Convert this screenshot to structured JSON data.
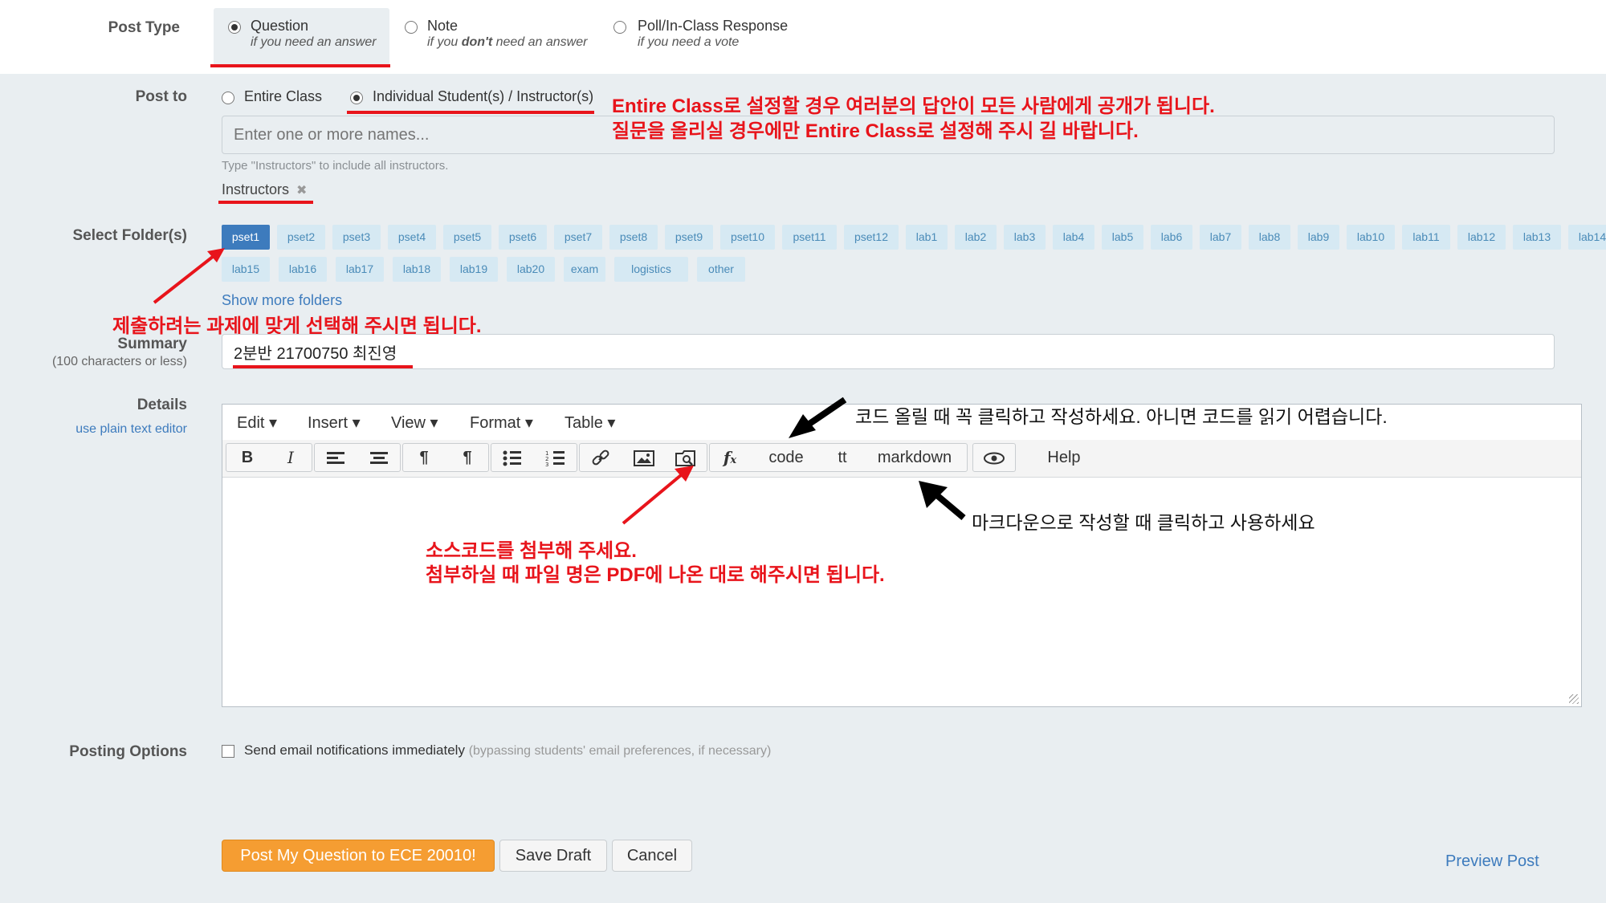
{
  "post_type": {
    "label": "Post Type",
    "options": [
      {
        "title": "Question",
        "sub": "if you need an answer",
        "selected": true
      },
      {
        "title": "Note",
        "sub_pre": "if you ",
        "sub_em": "don't",
        "sub_post": " need an answer",
        "selected": false
      },
      {
        "title": "Poll/In-Class Response",
        "sub": "if you need a vote",
        "selected": false
      }
    ]
  },
  "post_to": {
    "label": "Post to",
    "entire_class": "Entire Class",
    "individual": "Individual Student(s) / Instructor(s)",
    "selected": "individual",
    "names_placeholder": "Enter one or more names...",
    "hint": "Type \"Instructors\" to include all instructors.",
    "token": "Instructors"
  },
  "annotations": {
    "post_to_note_1": "Entire Class로 설정할 경우 여러분의 답안이 모든 사람에게 공개가 됩니다.",
    "post_to_note_2": "질문을 올리실 경우에만 Entire Class로 설정해 주시 길 바랍니다.",
    "folder_note": "제출하려는 과제에 맞게 선택해 주시면 됩니다.",
    "code_note": "코드 올릴 때 꼭 클릭하고 작성하세요. 아니면 코드를 읽기 어렵습니다.",
    "markdown_note": "마크다운으로 작성할 때 클릭하고 사용하세요",
    "attach_note_1": "소스코드를 첨부해 주세요.",
    "attach_note_2": "첨부하실 때 파일 명은 PDF에 나온 대로 해주시면 됩니다.",
    "accent_color": "#e8141b"
  },
  "folders": {
    "label": "Select Folder(s)",
    "selected": "pset1",
    "row1": [
      "pset1",
      "pset2",
      "pset3",
      "pset4",
      "pset5",
      "pset6",
      "pset7",
      "pset8",
      "pset9",
      "pset10",
      "pset11",
      "pset12",
      "lab1",
      "lab2",
      "lab3",
      "lab4",
      "lab5",
      "lab6",
      "lab7",
      "lab8",
      "lab9",
      "lab10",
      "lab11",
      "lab12",
      "lab13",
      "lab14"
    ],
    "row2": [
      "lab15",
      "lab16",
      "lab17",
      "lab18",
      "lab19",
      "lab20",
      "exam",
      "logistics",
      "other"
    ],
    "show_more": "Show more folders"
  },
  "summary": {
    "label": "Summary",
    "sublabel": "(100 characters or less)",
    "value": "2분반 21700750 최진영"
  },
  "details": {
    "label": "Details",
    "plain_editor_link": "use plain text editor",
    "menus": [
      "Edit",
      "Insert",
      "View",
      "Format",
      "Table"
    ],
    "toolbar": {
      "code": "code",
      "tt": "tt",
      "markdown": "markdown",
      "help": "Help"
    }
  },
  "posting_options": {
    "label": "Posting Options",
    "email_label": "Send email notifications immediately",
    "email_note": "(bypassing students' email preferences, if necessary)",
    "checked": false
  },
  "buttons": {
    "post": "Post My Question to ECE 20010!",
    "save_draft": "Save Draft",
    "cancel": "Cancel",
    "preview": "Preview Post"
  }
}
